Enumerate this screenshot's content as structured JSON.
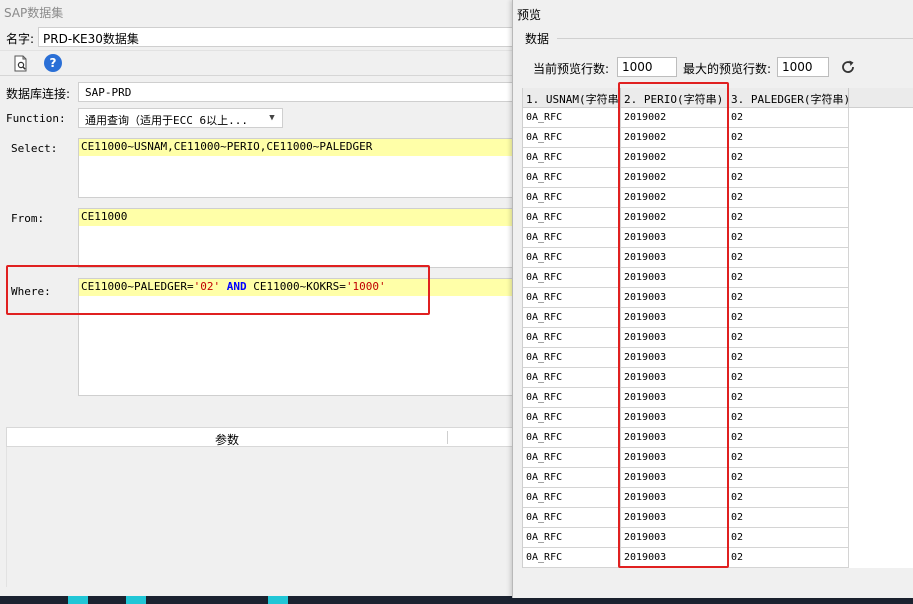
{
  "left_window": {
    "title": "SAP数据集",
    "name_label": "名字:",
    "name_value": "PRD-KE30数据集",
    "connection_label": "数据库连接:",
    "connection_value": "SAP-PRD",
    "function_label": "Function:",
    "function_value": "通用查询（适用于ECC 6以上...",
    "select_label": "Select:",
    "select_value": "CE11000~USNAM,CE11000~PERIO,CE11000~PALEDGER",
    "from_label": "From:",
    "from_value": "CE11000",
    "where_label": "Where:",
    "where": {
      "part1": "CE11000~PALEDGER=",
      "value1": "'02'",
      "keyword": "AND",
      "part2": " CE11000~KOKRS=",
      "value2": "'1000'"
    },
    "params_header": "参数"
  },
  "right_window": {
    "title": "预览",
    "group_label": "数据",
    "current_rows_label": "当前预览行数:",
    "current_rows_value": "1000",
    "max_rows_label": "最大的预览行数:",
    "max_rows_value": "1000",
    "columns": [
      "1. USNAM(字符串)",
      "2. PERIO(字符串)",
      "3. PALEDGER(字符串)"
    ],
    "rows": [
      [
        "0A_RFC",
        "2019002",
        "02"
      ],
      [
        "0A_RFC",
        "2019002",
        "02"
      ],
      [
        "0A_RFC",
        "2019002",
        "02"
      ],
      [
        "0A_RFC",
        "2019002",
        "02"
      ],
      [
        "0A_RFC",
        "2019002",
        "02"
      ],
      [
        "0A_RFC",
        "2019002",
        "02"
      ],
      [
        "0A_RFC",
        "2019003",
        "02"
      ],
      [
        "0A_RFC",
        "2019003",
        "02"
      ],
      [
        "0A_RFC",
        "2019003",
        "02"
      ],
      [
        "0A_RFC",
        "2019003",
        "02"
      ],
      [
        "0A_RFC",
        "2019003",
        "02"
      ],
      [
        "0A_RFC",
        "2019003",
        "02"
      ],
      [
        "0A_RFC",
        "2019003",
        "02"
      ],
      [
        "0A_RFC",
        "2019003",
        "02"
      ],
      [
        "0A_RFC",
        "2019003",
        "02"
      ],
      [
        "0A_RFC",
        "2019003",
        "02"
      ],
      [
        "0A_RFC",
        "2019003",
        "02"
      ],
      [
        "0A_RFC",
        "2019003",
        "02"
      ],
      [
        "0A_RFC",
        "2019003",
        "02"
      ],
      [
        "0A_RFC",
        "2019003",
        "02"
      ],
      [
        "0A_RFC",
        "2019003",
        "02"
      ],
      [
        "0A_RFC",
        "2019003",
        "02"
      ],
      [
        "0A_RFC",
        "2019003",
        "02"
      ]
    ]
  },
  "colors": {
    "sql_highlight": "#ffffa8",
    "annotation_red": "#e02020",
    "keyword_blue": "#0000ff",
    "string_red": "#c00000",
    "help_icon": "#2a6fd6"
  },
  "icons": {
    "toolbar_doc": "preview-document-icon",
    "toolbar_help": "help-icon",
    "refresh": "refresh-icon",
    "dropdown": "chevron-down-icon"
  }
}
